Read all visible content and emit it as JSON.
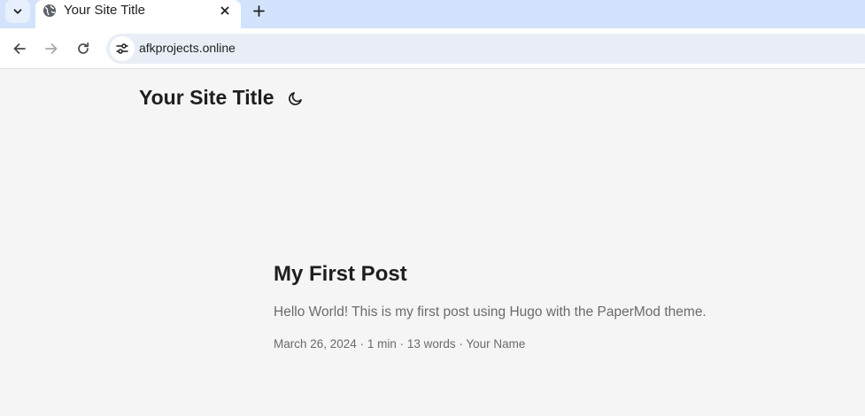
{
  "browser": {
    "tab": {
      "title": "Your Site Title"
    },
    "address_bar": {
      "url": "afkprojects.online"
    }
  },
  "page": {
    "site_title": "Your Site Title",
    "post": {
      "title": "My First Post",
      "summary": "Hello World! This is my first post using Hugo with the PaperMod theme.",
      "meta": {
        "date": "March 26, 2024",
        "reading_time": "1 min",
        "word_count": "13 words",
        "author": "Your Name",
        "separator": " · "
      }
    }
  }
}
